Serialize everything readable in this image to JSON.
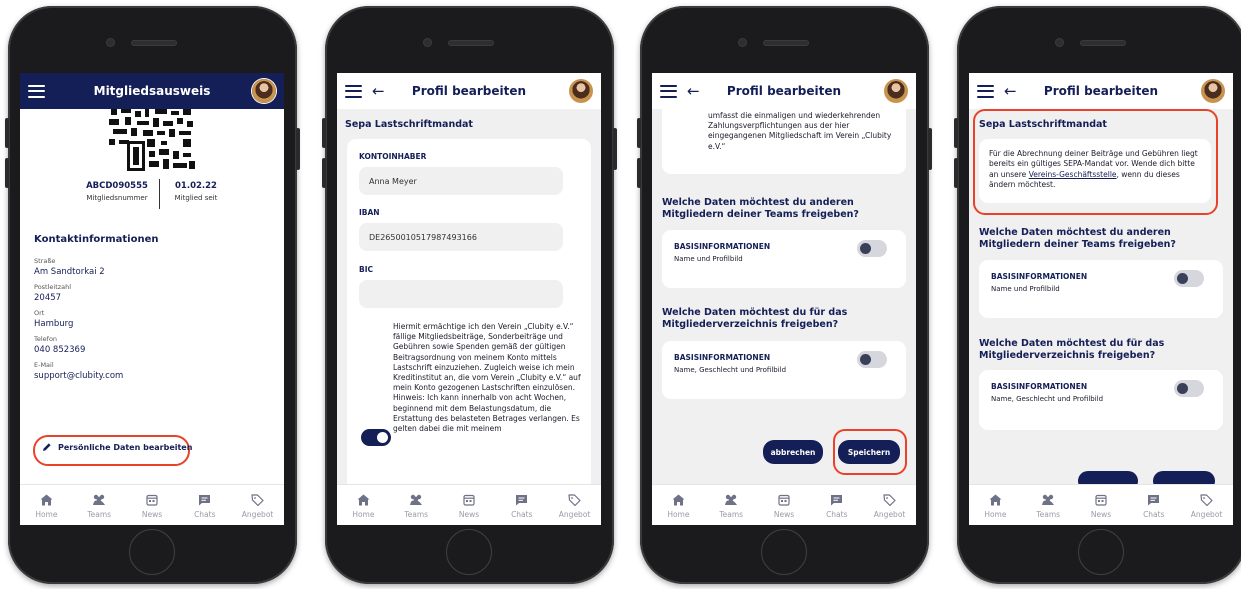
{
  "tabbar": [
    {
      "icon": "home-icon",
      "label": "Home"
    },
    {
      "icon": "teams-icon",
      "label": "Teams"
    },
    {
      "icon": "news-icon",
      "label": "News"
    },
    {
      "icon": "chats-icon",
      "label": "Chats"
    },
    {
      "icon": "offer-icon",
      "label": "Angebot"
    }
  ],
  "screen1": {
    "title": "Mitgliedsausweis",
    "member_number": "ABCD090555",
    "member_number_label": "Mitgliedsnummer",
    "member_since": "01.02.22",
    "member_since_label": "Mitglied seit",
    "contact_heading": "Kontaktinformationen",
    "fields": [
      {
        "label": "Straße",
        "value": "Am Sandtorkai 2"
      },
      {
        "label": "Postleitzahl",
        "value": "20457"
      },
      {
        "label": "Ort",
        "value": "Hamburg"
      },
      {
        "label": "Telefon",
        "value": "040 852369"
      },
      {
        "label": "E-Mail",
        "value": "support@clubity.com"
      }
    ],
    "edit_label": "Persönliche Daten bearbeiten"
  },
  "screen2": {
    "title": "Profil bearbeiten",
    "section": "Sepa Lastschriftmandat",
    "kontoinhaber_label": "KONTOINHABER",
    "kontoinhaber": "Anna Meyer",
    "iban_label": "IBAN",
    "iban": "DE2650010517987493166",
    "bic_label": "BIC",
    "bic": "",
    "mandate_text": "Hiermit ermächtige ich den Verein „Clubity e.V.“ fällige Mitgliedsbeiträge, Sonderbeiträge und Gebühren sowie Spenden gemäß der gültigen Beitragsordnung von meinem Konto mittels Lastschrift einzuziehen. Zugleich weise ich mein Kreditinstitut an, die vom Verein „Clubity e.V.“ auf mein Konto gezogenen Lastschriften einzulösen. Hinweis: Ich kann innerhalb von acht Wochen, beginnend mit dem Belastungsdatum, die Erstattung des belasteten Betrages verlangen. Es gelten dabei die mit meinem"
  },
  "screen3": {
    "title": "Profil bearbeiten",
    "top_text": "umfasst die einmaligen und wiederkehrenden Zahlungsverpflichtungen aus der hier eingegangenen Mitgliedschaft im Verein „Clubity e.V.“",
    "q1": "Welche Daten möchtest du anderen Mitgliedern deiner Teams freigeben?",
    "card1_title": "BASISINFORMATIONEN",
    "card1_sub": "Name und Profilbild",
    "q2": "Welche Daten möchtest du für das Mitgliederverzeichnis freigeben?",
    "card2_title": "BASISINFORMATIONEN",
    "card2_sub": "Name, Geschlecht und Profilbild",
    "cancel_label": "abbrechen",
    "save_label": "Speichern"
  },
  "screen4": {
    "title": "Profil bearbeiten",
    "section": "Sepa Lastschriftmandat",
    "notice_text": "Für die Abrechnung deiner Beiträge und Gebühren liegt bereits ein gültiges SEPA-Mandat vor. Wende dich bitte an unsere",
    "notice_link": "Vereins-Geschäftsstelle",
    "notice_tail": ", wenn du dieses ändern möchtest.",
    "q1": "Welche Daten möchtest du anderen Mitgliedern deiner Teams freigeben?",
    "card1_title": "BASISINFORMATIONEN",
    "card1_sub": "Name und Profilbild",
    "q2": "Welche Daten möchtest du für das Mitgliederverzeichnis freigeben?",
    "card2_title": "BASISINFORMATIONEN",
    "card2_sub": "Name, Geschlecht und Profilbild"
  }
}
